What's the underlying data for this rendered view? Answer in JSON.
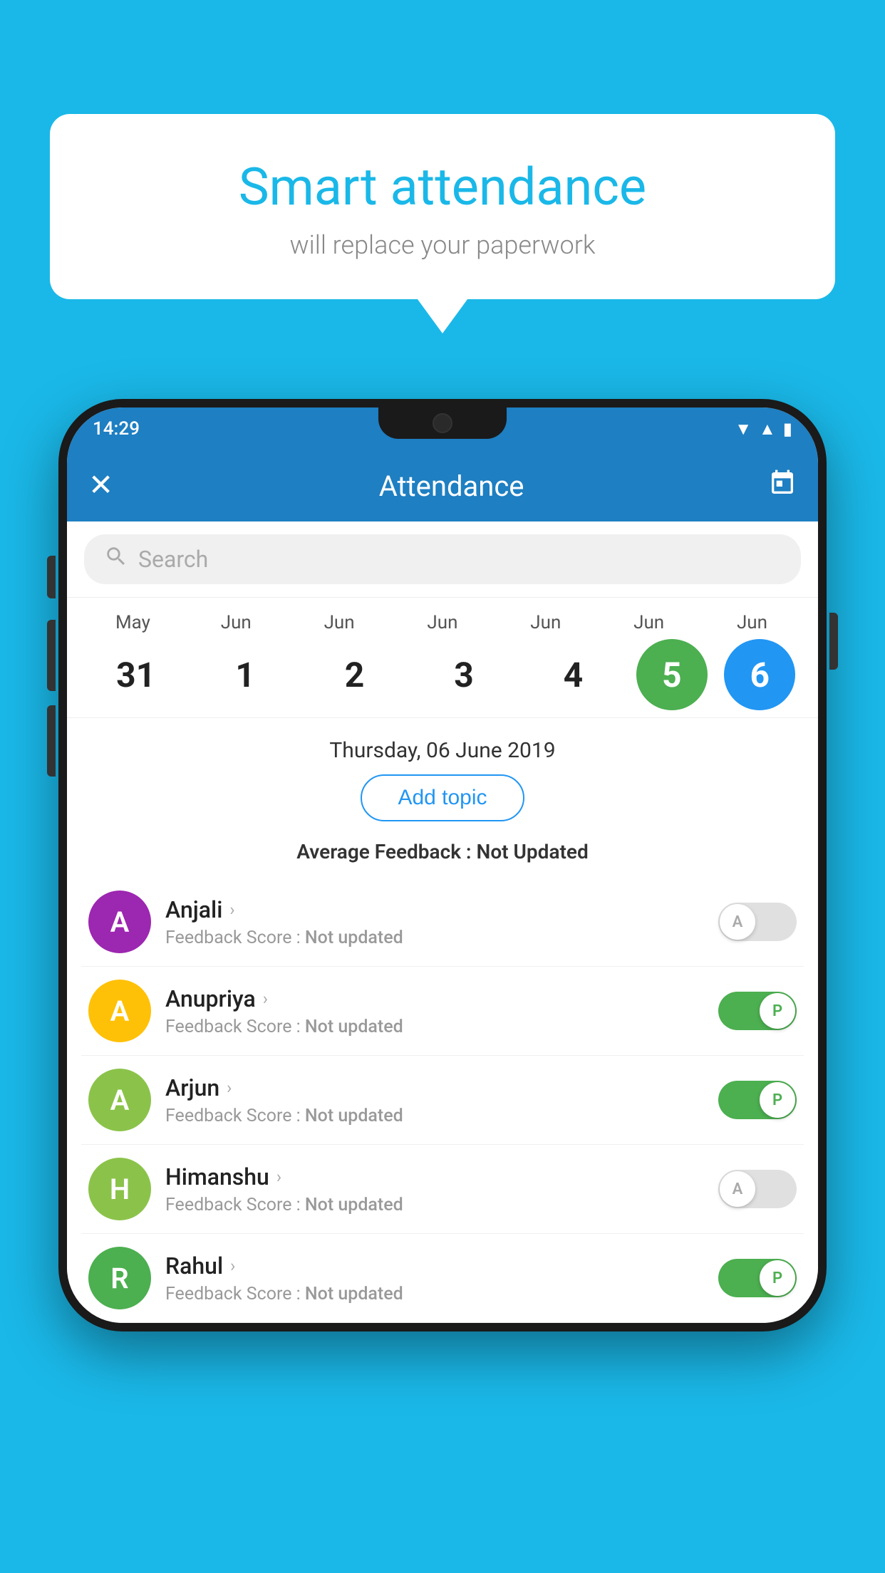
{
  "background_color": "#1ab8e8",
  "bubble": {
    "title": "Smart attendance",
    "subtitle": "will replace your paperwork"
  },
  "phone": {
    "status_bar": {
      "time": "14:29",
      "icons": [
        "wifi",
        "signal",
        "battery"
      ]
    },
    "app_bar": {
      "title": "Attendance",
      "close_icon": "✕",
      "calendar_icon": "📅"
    },
    "search": {
      "placeholder": "Search"
    },
    "calendar": {
      "months": [
        "May",
        "Jun",
        "Jun",
        "Jun",
        "Jun",
        "Jun",
        "Jun"
      ],
      "dates": [
        {
          "date": "31",
          "month": "May",
          "active": false,
          "today": false
        },
        {
          "date": "1",
          "month": "Jun",
          "active": false,
          "today": false
        },
        {
          "date": "2",
          "month": "Jun",
          "active": false,
          "today": false
        },
        {
          "date": "3",
          "month": "Jun",
          "active": false,
          "today": false
        },
        {
          "date": "4",
          "month": "Jun",
          "active": false,
          "today": false
        },
        {
          "date": "5",
          "month": "Jun",
          "active": true,
          "today": false,
          "color": "green"
        },
        {
          "date": "6",
          "month": "Jun",
          "active": true,
          "today": true,
          "color": "blue"
        }
      ]
    },
    "selected_date": "Thursday, 06 June 2019",
    "add_topic_label": "Add topic",
    "avg_feedback_label": "Average Feedback :",
    "avg_feedback_value": "Not Updated",
    "students": [
      {
        "name": "Anjali",
        "avatar_letter": "A",
        "avatar_color": "#9c27b0",
        "feedback_label": "Feedback Score :",
        "feedback_value": "Not updated",
        "status": "absent",
        "toggle_letter": "A"
      },
      {
        "name": "Anupriya",
        "avatar_letter": "A",
        "avatar_color": "#ffc107",
        "feedback_label": "Feedback Score :",
        "feedback_value": "Not updated",
        "status": "present",
        "toggle_letter": "P"
      },
      {
        "name": "Arjun",
        "avatar_letter": "A",
        "avatar_color": "#8bc34a",
        "feedback_label": "Feedback Score :",
        "feedback_value": "Not updated",
        "status": "present",
        "toggle_letter": "P"
      },
      {
        "name": "Himanshu",
        "avatar_letter": "H",
        "avatar_color": "#8bc34a",
        "feedback_label": "Feedback Score :",
        "feedback_value": "Not updated",
        "status": "absent",
        "toggle_letter": "A"
      },
      {
        "name": "Rahul",
        "avatar_letter": "R",
        "avatar_color": "#4caf50",
        "feedback_label": "Feedback Score :",
        "feedback_value": "Not updated",
        "status": "present",
        "toggle_letter": "P"
      }
    ]
  }
}
